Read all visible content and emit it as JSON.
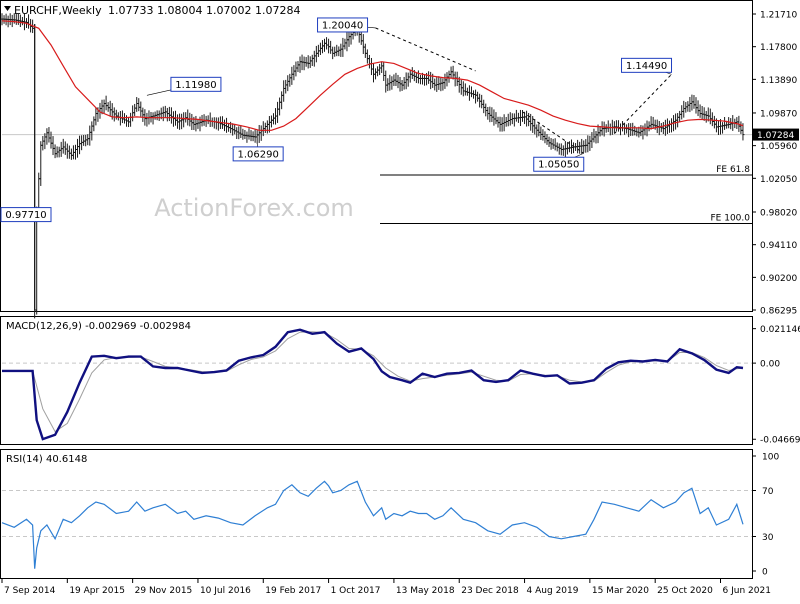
{
  "header": {
    "symbol": "EURCHF,Weekly",
    "ohlc": "1.07733 1.08004 1.07002 1.07284"
  },
  "watermark": "ActionForex.com",
  "colors": {
    "price": "#1a1a1a",
    "ma": "#d81b1b",
    "macd": "#101080",
    "macd_signal": "#a0a0a0",
    "rsi": "#2e7fd4",
    "grid": "#c8c8c8",
    "last_price_bg": "#000000"
  },
  "chart_data": [
    {
      "type": "line",
      "name": "price",
      "title": "EURCHF,Weekly",
      "ylim": [
        0.86295,
        1.2171
      ],
      "y_ticks": [
        "1.21710",
        "1.17800",
        "1.13890",
        "1.09870",
        "1.05960",
        "1.02050",
        "0.98020",
        "0.94110",
        "0.90200",
        "0.86295"
      ],
      "last_price": "1.07284",
      "x_ticks": [
        "7 Sep 2014",
        "19 Apr 2015",
        "29 Nov 2015",
        "10 Jul 2016",
        "19 Feb 2017",
        "1 Oct 2017",
        "13 May 2018",
        "23 Dec 2018",
        "4 Aug 2019",
        "15 Mar 2020",
        "25 Oct 2020",
        "6 Jun 2021"
      ],
      "x_tick_values": [
        0,
        32,
        64,
        96,
        128,
        160,
        192,
        224,
        256,
        288,
        320,
        352
      ],
      "weeks_total": 364,
      "series": [
        {
          "name": "",
          "x": [
            0,
            6,
            12,
            15,
            16,
            17,
            19,
            22,
            26,
            30,
            34,
            38,
            42,
            46,
            50,
            56,
            62,
            66,
            70,
            74,
            80,
            86,
            90,
            94,
            100,
            106,
            112,
            118,
            124,
            130,
            134,
            138,
            142,
            146,
            150,
            154,
            158,
            160,
            162,
            166,
            170,
            174,
            178,
            182,
            186,
            188,
            192,
            196,
            200,
            204,
            208,
            212,
            216,
            220,
            226,
            232,
            238,
            244,
            250,
            256,
            262,
            268,
            274,
            280,
            286,
            290,
            294,
            300,
            306,
            312,
            318,
            324,
            330,
            334,
            338,
            342,
            346,
            350,
            356,
            360,
            363
          ],
          "y": [
            1.211,
            1.21,
            1.207,
            1.2,
            0.8629,
            0.98,
            1.06,
            1.075,
            1.05,
            1.058,
            1.048,
            1.062,
            1.068,
            1.098,
            1.11,
            1.095,
            1.088,
            1.11,
            1.092,
            1.095,
            1.1,
            1.088,
            1.093,
            1.085,
            1.09,
            1.087,
            1.08,
            1.072,
            1.07,
            1.085,
            1.095,
            1.128,
            1.145,
            1.16,
            1.158,
            1.17,
            1.182,
            1.178,
            1.17,
            1.175,
            1.19,
            1.2,
            1.17,
            1.145,
            1.155,
            1.132,
            1.138,
            1.132,
            1.145,
            1.14,
            1.14,
            1.132,
            1.135,
            1.148,
            1.125,
            1.12,
            1.098,
            1.085,
            1.092,
            1.094,
            1.078,
            1.063,
            1.055,
            1.058,
            1.06,
            1.07,
            1.08,
            1.082,
            1.08,
            1.075,
            1.085,
            1.08,
            1.09,
            1.104,
            1.112,
            1.098,
            1.095,
            1.082,
            1.085,
            1.088,
            1.0728
          ]
        },
        {
          "name": "",
          "x": [
            0,
            6,
            12,
            18,
            24,
            30,
            36,
            42,
            48,
            54,
            60,
            66,
            72,
            78,
            84,
            90,
            96,
            102,
            108,
            114,
            120,
            126,
            132,
            138,
            144,
            150,
            156,
            162,
            168,
            174,
            180,
            186,
            192,
            198,
            204,
            210,
            216,
            222,
            228,
            234,
            240,
            246,
            252,
            258,
            264,
            270,
            276,
            282,
            288,
            294,
            300,
            306,
            312,
            318,
            324,
            330,
            336,
            342,
            348,
            354,
            360,
            363
          ],
          "y": [
            1.209,
            1.208,
            1.206,
            1.2,
            1.18,
            1.155,
            1.13,
            1.115,
            1.1,
            1.094,
            1.093,
            1.094,
            1.093,
            1.093,
            1.093,
            1.092,
            1.091,
            1.089,
            1.087,
            1.085,
            1.082,
            1.078,
            1.078,
            1.083,
            1.092,
            1.106,
            1.12,
            1.133,
            1.145,
            1.152,
            1.157,
            1.16,
            1.158,
            1.152,
            1.146,
            1.143,
            1.141,
            1.14,
            1.138,
            1.132,
            1.124,
            1.116,
            1.112,
            1.108,
            1.102,
            1.095,
            1.09,
            1.086,
            1.083,
            1.082,
            1.081,
            1.081,
            1.081,
            1.08,
            1.083,
            1.087,
            1.09,
            1.091,
            1.09,
            1.089,
            1.086,
            1.0835
          ]
        }
      ],
      "annotations": [
        {
          "label": "1.20040",
          "x": 183,
          "y": 1.2004
        },
        {
          "label": "1.11980",
          "x": 71,
          "y": 1.1198
        },
        {
          "label": "1.06290",
          "x": 125,
          "y": 1.0629
        },
        {
          "label": "1.05050",
          "x": 285,
          "y": 1.0505
        },
        {
          "label": "1.14490",
          "x": 328,
          "y": 1.1449
        },
        {
          "label": "0.97710",
          "x": 16,
          "y": 0.9771
        }
      ],
      "levels": [
        {
          "label": "FE 61.8",
          "value": 1.0245
        },
        {
          "label": "FE 100.0",
          "value": 0.9665
        }
      ],
      "trendlines": [
        {
          "x": [
            183,
            232
          ],
          "y": [
            1.2004,
            1.149
          ]
        },
        {
          "x": [
            255,
            285
          ],
          "y": [
            1.1,
            1.0505
          ]
        },
        {
          "x": [
            300,
            328
          ],
          "y": [
            1.074,
            1.1449
          ]
        }
      ]
    },
    {
      "type": "line",
      "name": "macd",
      "title": "MACD(12,26,9) -0.002969 -0.002984",
      "ylim": [
        -0.049,
        0.024
      ],
      "y_ticks": [
        "0.021146",
        "0.00",
        "-0.046699"
      ],
      "last_label": "0.00",
      "series": [
        {
          "name": "",
          "x": [
            0,
            8,
            15,
            17,
            20,
            26,
            32,
            38,
            44,
            50,
            56,
            62,
            68,
            74,
            80,
            86,
            92,
            98,
            104,
            110,
            116,
            122,
            128,
            134,
            140,
            146,
            152,
            158,
            164,
            170,
            176,
            182,
            186,
            190,
            196,
            200,
            206,
            212,
            218,
            224,
            230,
            236,
            242,
            248,
            254,
            260,
            266,
            272,
            278,
            284,
            290,
            296,
            302,
            308,
            314,
            320,
            326,
            332,
            338,
            344,
            350,
            356,
            360,
            363
          ],
          "y": [
            -0.0048,
            -0.0048,
            -0.0048,
            -0.035,
            -0.0466,
            -0.044,
            -0.03,
            -0.012,
            0.004,
            0.0045,
            0.003,
            0.004,
            0.004,
            -0.002,
            -0.003,
            -0.003,
            -0.0045,
            -0.006,
            -0.0055,
            -0.0045,
            0.0015,
            0.0035,
            0.005,
            0.01,
            0.019,
            0.0205,
            0.018,
            0.019,
            0.012,
            0.007,
            0.009,
            0.0025,
            -0.005,
            -0.0085,
            -0.0105,
            -0.012,
            -0.0065,
            -0.0085,
            -0.0065,
            -0.006,
            -0.0045,
            -0.0105,
            -0.0115,
            -0.0105,
            -0.0045,
            -0.0065,
            -0.008,
            -0.0075,
            -0.0125,
            -0.012,
            -0.0105,
            -0.0035,
            0.0005,
            0.0015,
            0.001,
            0.002,
            0.001,
            0.0085,
            0.006,
            0.002,
            -0.004,
            -0.006,
            -0.0025,
            -0.003
          ]
        },
        {
          "name": "",
          "x": [
            0,
            15,
            20,
            26,
            32,
            38,
            44,
            50,
            56,
            62,
            68,
            74,
            80,
            86,
            92,
            98,
            104,
            110,
            116,
            122,
            128,
            134,
            140,
            146,
            152,
            158,
            164,
            170,
            176,
            182,
            188,
            194,
            200,
            206,
            212,
            218,
            224,
            230,
            236,
            242,
            248,
            254,
            260,
            266,
            272,
            278,
            284,
            290,
            296,
            302,
            308,
            314,
            320,
            326,
            332,
            338,
            344,
            350,
            356,
            360,
            363
          ],
          "y": [
            -0.0048,
            -0.0048,
            -0.028,
            -0.042,
            -0.037,
            -0.022,
            -0.006,
            0.002,
            0.0035,
            0.0035,
            0.0038,
            0.001,
            -0.002,
            -0.003,
            -0.004,
            -0.0052,
            -0.0056,
            -0.005,
            -0.001,
            0.0022,
            0.0038,
            0.0075,
            0.015,
            0.019,
            0.0192,
            0.0188,
            0.0145,
            0.009,
            0.0085,
            0.0045,
            -0.003,
            -0.008,
            -0.011,
            -0.0095,
            -0.0085,
            -0.0075,
            -0.0065,
            -0.0055,
            -0.008,
            -0.0105,
            -0.011,
            -0.007,
            -0.0065,
            -0.0075,
            -0.0078,
            -0.0105,
            -0.0115,
            -0.011,
            -0.0058,
            -0.0012,
            0.0008,
            0.001,
            0.0015,
            0.0012,
            0.0065,
            0.0065,
            0.0035,
            -0.0015,
            -0.0045,
            -0.0035,
            -0.003
          ]
        }
      ]
    },
    {
      "type": "line",
      "name": "rsi",
      "title": "RSI(14) 40.6148",
      "ylim": [
        0,
        100
      ],
      "y_ticks": [
        "100",
        "70",
        "30",
        "0"
      ],
      "levels": [
        70,
        30
      ],
      "series": [
        {
          "name": "",
          "x": [
            0,
            6,
            12,
            15,
            16,
            17,
            19,
            22,
            26,
            30,
            34,
            38,
            42,
            46,
            50,
            56,
            62,
            66,
            70,
            74,
            80,
            86,
            90,
            94,
            100,
            106,
            112,
            118,
            124,
            130,
            134,
            138,
            142,
            146,
            150,
            154,
            158,
            160,
            162,
            166,
            170,
            174,
            178,
            182,
            186,
            188,
            192,
            196,
            200,
            204,
            208,
            212,
            216,
            220,
            226,
            232,
            238,
            244,
            250,
            256,
            262,
            268,
            274,
            280,
            286,
            290,
            294,
            300,
            306,
            312,
            318,
            324,
            330,
            334,
            338,
            342,
            346,
            350,
            356,
            360,
            363
          ],
          "y": [
            42,
            38,
            45,
            40,
            2,
            20,
            35,
            40,
            28,
            45,
            42,
            48,
            55,
            60,
            58,
            50,
            52,
            60,
            52,
            55,
            58,
            50,
            52,
            45,
            48,
            46,
            42,
            40,
            48,
            55,
            58,
            70,
            75,
            68,
            65,
            72,
            78,
            74,
            68,
            70,
            75,
            78,
            60,
            48,
            55,
            45,
            50,
            48,
            52,
            50,
            50,
            45,
            48,
            55,
            45,
            42,
            35,
            32,
            40,
            42,
            38,
            30,
            28,
            30,
            32,
            45,
            60,
            58,
            55,
            52,
            62,
            55,
            60,
            68,
            72,
            50,
            55,
            40,
            45,
            58,
            40.6
          ]
        }
      ]
    }
  ]
}
